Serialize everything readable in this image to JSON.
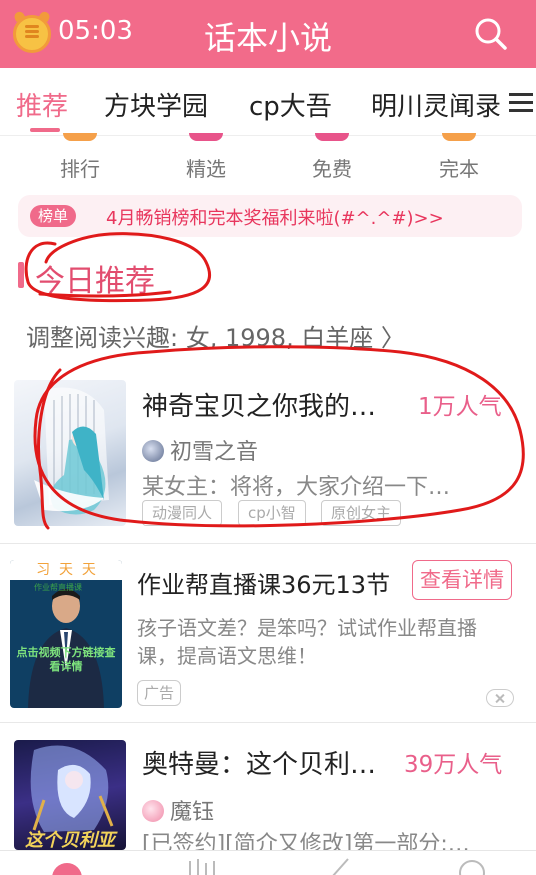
{
  "statusbar": {
    "time": "05:03"
  },
  "header": {
    "title": "话本小说"
  },
  "tabs": [
    {
      "label": "推荐"
    },
    {
      "label": "方块学园"
    },
    {
      "label": "cp大吾"
    },
    {
      "label": "明川灵闻录"
    }
  ],
  "quick_nav": [
    {
      "label": "排行",
      "color": "#f5a04a"
    },
    {
      "label": "精选",
      "color": "#e8548a"
    },
    {
      "label": "免费",
      "color": "#e8548a"
    },
    {
      "label": "完本",
      "color": "#f5a04a"
    }
  ],
  "notice": {
    "badge": "榜单",
    "text": "4月畅销榜和完本奖福利来啦(#^.^#)>>"
  },
  "section": {
    "title": "今日推荐",
    "subtitle": "调整阅读兴趣: 女, 1998, 白羊座 〉"
  },
  "books": [
    {
      "title": "神奇宝贝之你我的…",
      "popularity": "1万人气",
      "author": "初雪之音",
      "intro": "某女主：将将，大家介绍一下…",
      "tags": [
        "动漫同人",
        "cp小智",
        "原创女主"
      ]
    },
    {
      "title": "奥特曼：这个贝利…",
      "popularity": "39万人气",
      "author": "魔钰",
      "intro": "[已签约][简介又修改]第一部分:…"
    }
  ],
  "ad": {
    "title": "作业帮直播课36元13节",
    "button": "查看详情",
    "description": "孩子语文差？是笨吗？试试作业帮直播课，提高语文思维！",
    "tag": "广告",
    "cover_banner": "习  天  天",
    "cover_caption": "点击视频下方链接查看详情",
    "cover_brand": "作业帮直播课"
  },
  "book2_cover_caption": "这个贝利亚"
}
